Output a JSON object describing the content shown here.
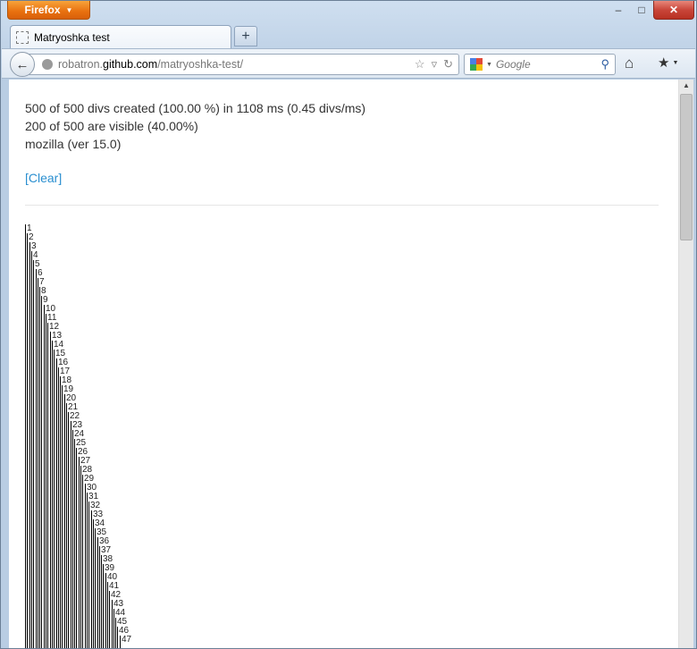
{
  "browser": {
    "menu_label": "Firefox",
    "tab_title": "Matryoshka test",
    "url_prefix": "robatron.",
    "url_host": "github.com",
    "url_path": "/matryoshka-test/",
    "search_placeholder": "Google",
    "win_minimize": "–",
    "win_maximize": "□",
    "win_close": "✕",
    "new_tab": "+",
    "back": "←",
    "star": "☆",
    "dropdown": "▿",
    "reload": "↻",
    "search_icon": "⚲",
    "home": "⌂",
    "bookmarks": "★",
    "caret": "▼"
  },
  "page": {
    "stats_line1": "500 of 500 divs created (100.00 %) in 1108 ms (0.45 divs/ms)",
    "stats_line2": "200 of 500 are visible (40.00%)",
    "stats_line3": "mozilla (ver 15.0)",
    "clear_link": "[Clear]",
    "nested_labels": [
      "1",
      "2",
      "3",
      "4",
      "5",
      "6",
      "7",
      "8",
      "9",
      "10",
      "11",
      "12",
      "13",
      "14",
      "15",
      "16",
      "17",
      "18",
      "19",
      "20",
      "21",
      "22",
      "23",
      "24",
      "25",
      "26",
      "27",
      "28",
      "29",
      "30",
      "31",
      "32",
      "33",
      "34",
      "35",
      "36",
      "37",
      "38",
      "39",
      "40",
      "41",
      "42",
      "43",
      "44",
      "45",
      "46",
      "47"
    ]
  },
  "icons": {
    "globe": "globe-icon",
    "google": "google-icon",
    "tab_favicon": "blank-page-icon"
  }
}
